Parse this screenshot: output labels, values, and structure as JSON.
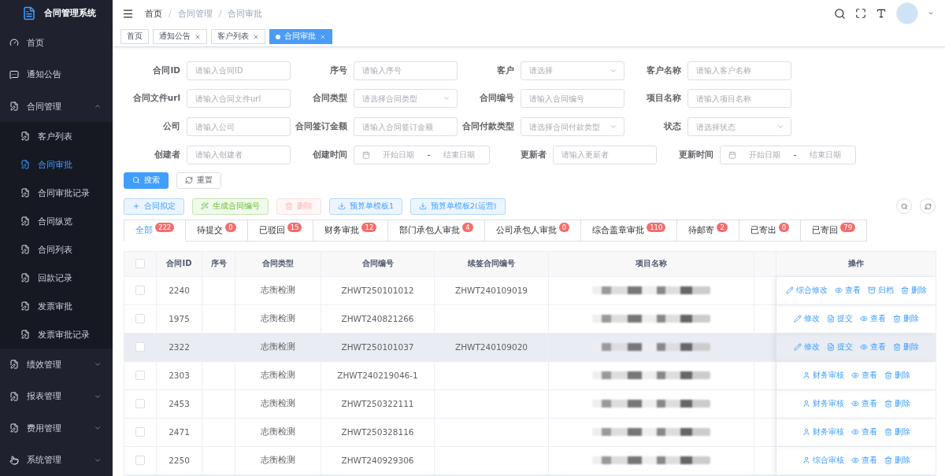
{
  "app": {
    "title": "合同管理系统"
  },
  "sidebar": {
    "items": [
      {
        "label": "首页",
        "selected": false
      },
      {
        "label": "通知公告",
        "selected": false
      },
      {
        "label": "合同管理",
        "selected": false,
        "expanded": true,
        "children": [
          {
            "label": "客户列表",
            "selected": false
          },
          {
            "label": "合同审批",
            "selected": true
          },
          {
            "label": "合同审批记录",
            "selected": false
          },
          {
            "label": "合同纵览",
            "selected": false
          },
          {
            "label": "合同列表",
            "selected": false
          },
          {
            "label": "回款记录",
            "selected": false
          },
          {
            "label": "发票审批",
            "selected": false
          },
          {
            "label": "发票审批记录",
            "selected": false
          }
        ]
      },
      {
        "label": "绩效管理",
        "selected": false,
        "expanded": false
      },
      {
        "label": "报表管理",
        "selected": false,
        "expanded": false
      },
      {
        "label": "费用管理",
        "selected": false,
        "expanded": false
      },
      {
        "label": "系统管理",
        "selected": false,
        "expanded": false
      }
    ]
  },
  "breadcrumb": {
    "items": [
      "首页",
      "合同管理",
      "合同审批"
    ],
    "separator": "/"
  },
  "tags": [
    {
      "label": "首页",
      "closable": false,
      "selected": false
    },
    {
      "label": "通知公告",
      "closable": true,
      "selected": false
    },
    {
      "label": "客户列表",
      "closable": true,
      "selected": false
    },
    {
      "label": "合同审批",
      "closable": true,
      "selected": true
    }
  ],
  "filters": [
    [
      {
        "label": "合同ID",
        "kind": "text",
        "placeholder": "请输入合同ID"
      },
      {
        "label": "序号",
        "kind": "text",
        "placeholder": "请输入序号"
      },
      {
        "label": "客户",
        "kind": "select",
        "placeholder": "请选择"
      },
      {
        "label": "客户名称",
        "kind": "text",
        "placeholder": "请输入客户名称"
      }
    ],
    [
      {
        "label": "合同文件url",
        "kind": "text",
        "placeholder": "请输入合同文件url"
      },
      {
        "label": "合同类型",
        "kind": "select",
        "placeholder": "请选择合同类型"
      },
      {
        "label": "合同编号",
        "kind": "text",
        "placeholder": "请输入合同编号"
      },
      {
        "label": "项目名称",
        "kind": "text",
        "placeholder": "请输入项目名称"
      }
    ],
    [
      {
        "label": "公司",
        "kind": "text",
        "placeholder": "请输入公司"
      },
      {
        "label": "合同签订金额",
        "kind": "text",
        "placeholder": "请输入合同签订金额"
      },
      {
        "label": "合同付款类型",
        "kind": "select",
        "placeholder": "请选择合同付款类型"
      },
      {
        "label": "状态",
        "kind": "select",
        "placeholder": "请选择状态"
      }
    ],
    [
      {
        "label": "创建者",
        "kind": "text",
        "placeholder": "请输入创建者"
      },
      {
        "label": "创建时间",
        "kind": "daterange",
        "start": "开始日期",
        "separator": "-",
        "end": "结束日期"
      },
      {
        "label": "更新者",
        "kind": "text",
        "placeholder": "请输入更新者"
      },
      {
        "label": "更新时间",
        "kind": "daterange",
        "start": "开始日期",
        "separator": "-",
        "end": "结束日期"
      }
    ]
  ],
  "search_buttons": [
    {
      "label": "搜索",
      "kind": "primary"
    },
    {
      "label": "重置",
      "kind": "default"
    }
  ],
  "toolbar": [
    {
      "label": "合同拟定",
      "kind": "plus",
      "disabled": false
    },
    {
      "label": "生成合同编号",
      "kind": "wand",
      "disabled": false
    },
    {
      "label": "删除",
      "kind": "delete",
      "disabled": true
    },
    {
      "label": "预算单模板1",
      "kind": "download",
      "disabled": false
    },
    {
      "label": "预算单模板2(运营)",
      "kind": "download",
      "disabled": false
    }
  ],
  "status_tabs": [
    {
      "label": "全部",
      "count": "222",
      "selected": true
    },
    {
      "label": "待提交",
      "count": "0",
      "selected": false
    },
    {
      "label": "已驳回",
      "count": "15",
      "selected": false
    },
    {
      "label": "财务审批",
      "count": "12",
      "selected": false
    },
    {
      "label": "部门承包人审批",
      "count": "4",
      "selected": false
    },
    {
      "label": "公司承包人审批",
      "count": "0",
      "selected": false
    },
    {
      "label": "综合盖章审批",
      "count": "110",
      "selected": false
    },
    {
      "label": "待邮寄",
      "count": "2",
      "selected": false
    },
    {
      "label": "已寄出",
      "count": "0",
      "selected": false
    },
    {
      "label": "已寄回",
      "count": "79",
      "selected": false
    }
  ],
  "table": {
    "all_checked": false,
    "columns": [
      "合同ID",
      "序号",
      "合同类型",
      "合同编号",
      "续签合同编号",
      "项目名称",
      "操作"
    ],
    "rows": [
      {
        "id": "2240",
        "type": "志衡检测",
        "number": "ZHWT250101012",
        "renewal": "ZHWT240109019",
        "checked": false,
        "selected": false,
        "actions": [
          {
            "kind": "edit",
            "label": "综合修改"
          },
          {
            "kind": "view",
            "label": "查看"
          },
          {
            "kind": "archive",
            "label": "归档"
          },
          {
            "kind": "delete",
            "label": "删除"
          }
        ]
      },
      {
        "id": "1975",
        "type": "志衡检测",
        "number": "ZHWT240821266",
        "checked": false,
        "selected": false,
        "actions": [
          {
            "kind": "edit",
            "label": "修改"
          },
          {
            "kind": "submit",
            "label": "提交"
          },
          {
            "kind": "view",
            "label": "查看"
          },
          {
            "kind": "delete",
            "label": "删除"
          }
        ]
      },
      {
        "id": "2322",
        "type": "志衡检测",
        "number": "ZHWT250101037",
        "renewal": "ZHWT240109020",
        "checked": false,
        "selected": true,
        "actions": [
          {
            "kind": "edit",
            "label": "修改"
          },
          {
            "kind": "submit",
            "label": "提交"
          },
          {
            "kind": "view",
            "label": "查看"
          },
          {
            "kind": "delete",
            "label": "删除"
          }
        ]
      },
      {
        "id": "2303",
        "type": "志衡检测",
        "number": "ZHWT240219046-1",
        "checked": false,
        "selected": false,
        "actions": [
          {
            "kind": "audit",
            "label": "财务审核"
          },
          {
            "kind": "view",
            "label": "查看"
          },
          {
            "kind": "delete",
            "label": "删除"
          }
        ]
      },
      {
        "id": "2453",
        "type": "志衡检测",
        "number": "ZHWT250322111",
        "checked": false,
        "selected": false,
        "actions": [
          {
            "kind": "audit",
            "label": "财务审核"
          },
          {
            "kind": "view",
            "label": "查看"
          },
          {
            "kind": "delete",
            "label": "删除"
          }
        ]
      },
      {
        "id": "2471",
        "type": "志衡检测",
        "number": "ZHWT250328116",
        "checked": false,
        "selected": false,
        "actions": [
          {
            "kind": "audit",
            "label": "财务审核"
          },
          {
            "kind": "view",
            "label": "查看"
          },
          {
            "kind": "delete",
            "label": "删除"
          }
        ]
      },
      {
        "id": "2250",
        "type": "志衡检测",
        "number": "ZHWT240929306",
        "checked": false,
        "selected": false,
        "actions": [
          {
            "kind": "audit",
            "label": "综合审核"
          },
          {
            "kind": "view",
            "label": "查看"
          },
          {
            "kind": "delete",
            "label": "删除"
          }
        ]
      }
    ]
  }
}
